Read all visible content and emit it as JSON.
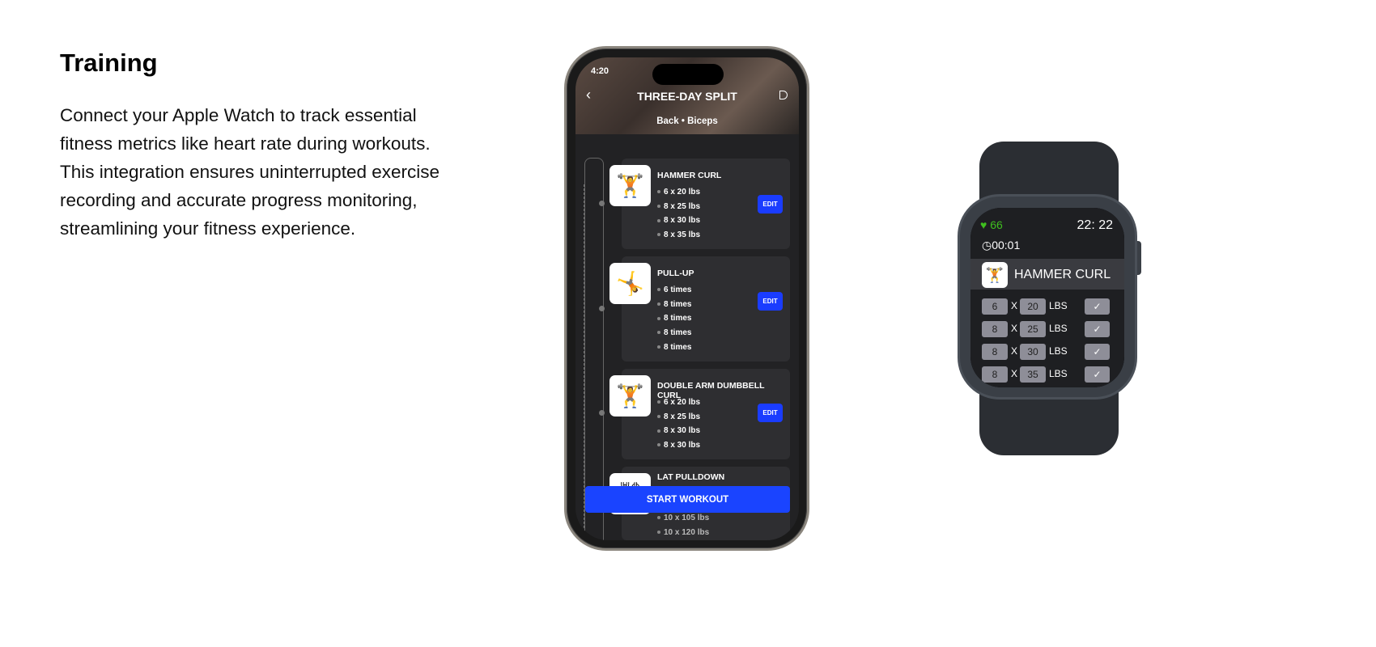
{
  "intro": {
    "heading": "Training",
    "body": "Connect your Apple Watch to track essential fitness metrics like heart rate during workouts. This integration ensures uninterrupted exercise recording and accurate progress monitoring, streamlining your fitness experience."
  },
  "phone": {
    "status_time": "4:20",
    "title": "THREE-DAY SPLIT",
    "subtitle": "Back • Biceps",
    "edit_label": "EDIT",
    "start_label": "START WORKOUT",
    "exercises": [
      {
        "name": "HAMMER CURL",
        "sets": [
          "6 x 20 lbs",
          "8 x 25 lbs",
          "8 x 30 lbs",
          "8 x 35 lbs"
        ]
      },
      {
        "name": "PULL-UP",
        "sets": [
          "6 times",
          "8 times",
          "8 times",
          "8 times",
          "8 times"
        ]
      },
      {
        "name": "DOUBLE ARM DUMBBELL CURL",
        "sets": [
          "6 x 20 lbs",
          "8 x 25 lbs",
          "8 x 30 lbs",
          "8 x 30 lbs"
        ]
      },
      {
        "name": "LAT PULLDOWN",
        "sets": [
          "10 x 105 lbs",
          "10 x 120 lbs"
        ]
      }
    ]
  },
  "watch": {
    "heart_rate": "66",
    "time": "22: 22",
    "timer": "00:01",
    "exercise": "HAMMER CURL",
    "x_label": "X",
    "unit": "LBS",
    "accent": "#3fbf1f",
    "sets": [
      {
        "reps": "6",
        "weight": "20"
      },
      {
        "reps": "8",
        "weight": "25"
      },
      {
        "reps": "8",
        "weight": "30"
      },
      {
        "reps": "8",
        "weight": "35"
      }
    ]
  }
}
